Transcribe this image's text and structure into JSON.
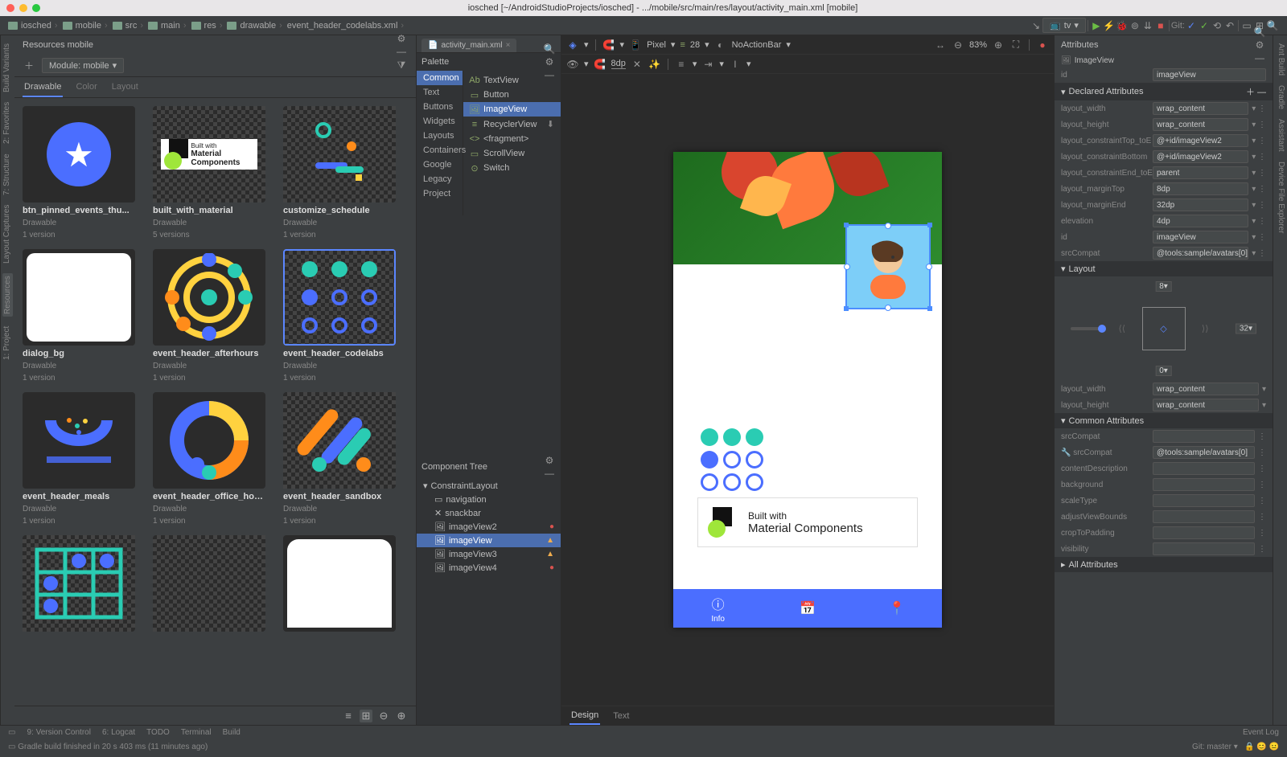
{
  "os_title": "iosched [~/AndroidStudioProjects/iosched] - .../mobile/src/main/res/layout/activity_main.xml [mobile]",
  "breadcrumbs": [
    "iosched",
    "mobile",
    "src",
    "main",
    "res",
    "drawable",
    "event_header_codelabs.xml"
  ],
  "toolbar": {
    "device_dropdown": "tv",
    "git_label": "Git:"
  },
  "resources": {
    "title": "Resources  mobile",
    "module_dropdown": "Module: mobile",
    "tabs": [
      "Drawable",
      "Color",
      "Layout"
    ],
    "active_tab": "Drawable",
    "items": [
      {
        "name": "btn_pinned_events_thu...",
        "type": "Drawable",
        "versions": "1 version"
      },
      {
        "name": "built_with_material",
        "type": "Drawable",
        "versions": "5 versions"
      },
      {
        "name": "customize_schedule",
        "type": "Drawable",
        "versions": "1 version"
      },
      {
        "name": "dialog_bg",
        "type": "Drawable",
        "versions": "1 version"
      },
      {
        "name": "event_header_afterhours",
        "type": "Drawable",
        "versions": "1 version"
      },
      {
        "name": "event_header_codelabs",
        "type": "Drawable",
        "versions": "1 version"
      },
      {
        "name": "event_header_meals",
        "type": "Drawable",
        "versions": "1 version"
      },
      {
        "name": "event_header_office_hours",
        "type": "Drawable",
        "versions": "1 version"
      },
      {
        "name": "event_header_sandbox",
        "type": "Drawable",
        "versions": "1 version"
      }
    ],
    "selected_index": 5
  },
  "editor_tab": "activity_main.xml",
  "palette": {
    "title": "Palette",
    "categories": [
      "Common",
      "Text",
      "Buttons",
      "Widgets",
      "Layouts",
      "Containers",
      "Google",
      "Legacy",
      "Project"
    ],
    "active_category": "Common",
    "items": [
      {
        "label": "TextView",
        "icon": "Ab"
      },
      {
        "label": "Button",
        "icon": "▭"
      },
      {
        "label": "ImageView",
        "icon": "🖼"
      },
      {
        "label": "RecyclerView",
        "icon": "≡"
      },
      {
        "label": "<fragment>",
        "icon": "< >"
      },
      {
        "label": "ScrollView",
        "icon": "▭"
      },
      {
        "label": "Switch",
        "icon": "⊙"
      }
    ],
    "active_item": "ImageView"
  },
  "component_tree": {
    "title": "Component Tree",
    "root": "ConstraintLayout",
    "children": [
      {
        "label": "navigation",
        "icon": "▭"
      },
      {
        "label": "snackbar",
        "icon": "✕"
      },
      {
        "label": "imageView2",
        "icon": "🖼",
        "badge": "error"
      },
      {
        "label": "imageView",
        "icon": "🖼",
        "badge": "warn",
        "selected": true
      },
      {
        "label": "imageView3",
        "icon": "🖼",
        "badge": "warn"
      },
      {
        "label": "imageView4",
        "icon": "🖼",
        "badge": "error"
      }
    ]
  },
  "design_toolbar": {
    "device": "Pixel",
    "api": "28",
    "theme": "NoActionBar",
    "zoom": "83%",
    "margin": "8dp"
  },
  "device": {
    "built_top": "Built with",
    "built_bottom": "Material Components",
    "nav_items": [
      "Info",
      "",
      ""
    ],
    "constraint_label": "32"
  },
  "attrs": {
    "title": "Attributes",
    "widget_type": "ImageView",
    "id_label": "id",
    "id_value": "imageView",
    "declared_title": "Declared Attributes",
    "rows": [
      {
        "k": "layout_width",
        "v": "wrap_content"
      },
      {
        "k": "layout_height",
        "v": "wrap_content"
      },
      {
        "k": "layout_constraintTop_toE",
        "v": "@+id/imageView2"
      },
      {
        "k": "layout_constraintBottom",
        "v": "@+id/imageView2"
      },
      {
        "k": "layout_constraintEnd_toE",
        "v": "parent"
      },
      {
        "k": "layout_marginTop",
        "v": "8dp"
      },
      {
        "k": "layout_marginEnd",
        "v": "32dp"
      },
      {
        "k": "elevation",
        "v": "4dp"
      },
      {
        "k": "id",
        "v": "imageView"
      },
      {
        "k": "srcCompat",
        "v": "@tools:sample/avatars[0]"
      }
    ],
    "layout_section": "Layout",
    "layout_top": "8",
    "layout_end": "32",
    "layout_bottom": "0",
    "layout_width": "wrap_content",
    "layout_height": "wrap_content",
    "common_title": "Common Attributes",
    "common": [
      {
        "k": "srcCompat",
        "v": ""
      },
      {
        "k": "srcCompat",
        "v": "@tools:sample/avatars[0]",
        "tool": true
      },
      {
        "k": "contentDescription",
        "v": ""
      },
      {
        "k": "background",
        "v": ""
      },
      {
        "k": "scaleType",
        "v": ""
      },
      {
        "k": "adjustViewBounds",
        "v": ""
      },
      {
        "k": "cropToPadding",
        "v": ""
      },
      {
        "k": "visibility",
        "v": ""
      }
    ],
    "all_title": "All Attributes"
  },
  "design_tabs": [
    "Design",
    "Text"
  ],
  "status": {
    "items": [
      "9: Version Control",
      "6: Logcat",
      "TODO",
      "Terminal",
      "Build"
    ],
    "msg": "Gradle build finished in 20 s 403 ms (11 minutes ago)",
    "event_log": "Event Log",
    "git_branch": "Git: master"
  }
}
